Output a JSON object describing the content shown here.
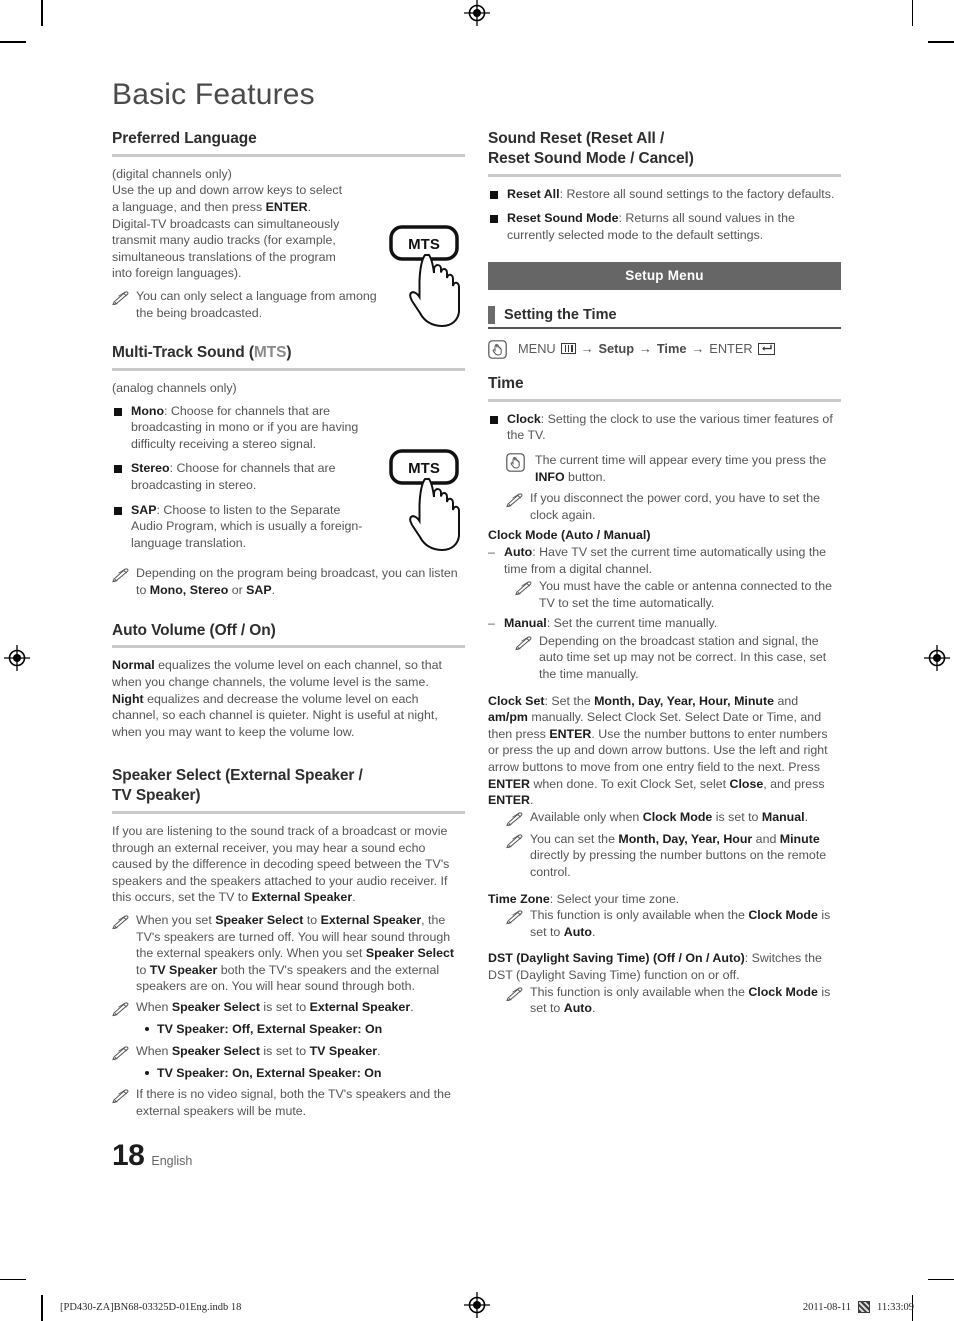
{
  "document": {
    "title": "Basic Features",
    "page_number": "18",
    "page_language": "English"
  },
  "left_column": {
    "preferred_language": {
      "heading": "Preferred Language",
      "p1": "(digital channels only)",
      "p2_a": "Use the up and down arrow keys to select a language, and then press ",
      "p2_b": "ENTER",
      "p2_c": ".",
      "p3": "Digital-TV broadcasts can simultaneously transmit many audio tracks (for example, simultaneous translations of the program into foreign languages).",
      "note1": "You can only select a language from among the being broadcasted.",
      "remote_button_label": "MTS"
    },
    "multi_track_sound": {
      "heading_main": "Multi-Track Sound (",
      "heading_muted": "MTS",
      "heading_tail": ")",
      "p1": "(analog channels only)",
      "items": [
        {
          "term": "Mono",
          "desc": ": Choose for channels that are broadcasting in mono or if you are having difficulty receiving a stereo signal."
        },
        {
          "term": "Stereo",
          "desc": ": Choose for channels that are broadcasting in stereo."
        },
        {
          "term": "SAP",
          "desc": ": Choose to listen to the Separate Audio Program, which is usually a foreign-language translation."
        }
      ],
      "note1_a": "Depending on the program being broadcast, you can listen to ",
      "note1_b": "Mono, Stereo",
      "note1_c": " or ",
      "note1_d": "SAP",
      "note1_e": ".",
      "remote_button_label": "MTS"
    },
    "auto_volume": {
      "heading": "Auto Volume (Off / On)",
      "p1_b": "Normal",
      "p1_t": " equalizes the volume level on each channel, so that when you change channels, the volume level is the same.",
      "p2_b": "Night",
      "p2_t": " equalizes and decrease the volume level on each channel, so each channel is quieter. Night is useful at night, when you may want to keep the volume low."
    },
    "speaker_select": {
      "heading_line1": "Speaker Select (External Speaker /",
      "heading_line2": "TV Speaker)",
      "p1_a": "If you are listening to the sound track of a broadcast or movie through an external receiver, you may hear a sound echo caused by the difference in decoding speed between the TV's speakers and the speakers attached to your audio receiver. If this occurs, set the TV to ",
      "p1_b": "External Speaker",
      "p1_c": ".",
      "note1_a": "When you set ",
      "note1_b": "Speaker Select",
      "note1_c": " to ",
      "note1_d": "External Speaker",
      "note1_e": ", the TV's speakers are turned off. You will hear sound through the external speakers only. When you set ",
      "note1_f": "Speaker Select",
      "note1_g": " to ",
      "note1_h": "TV Speaker",
      "note1_i": " both the TV's speakers and the external speakers are on. You will hear sound through both.",
      "note2_a": "When ",
      "note2_b": "Speaker Select",
      "note2_c": " is set to ",
      "note2_d": "External Speaker",
      "note2_e": ".",
      "bullet2": "TV Speaker: Off, External Speaker: On",
      "note3_a": "When ",
      "note3_b": "Speaker Select",
      "note3_c": " is set to ",
      "note3_d": "TV Speaker",
      "note3_e": ".",
      "bullet3": "TV Speaker: On, External Speaker: On",
      "note4": "If there is no video signal, both the TV's speakers and the external speakers will be mute."
    }
  },
  "right_column": {
    "sound_reset": {
      "heading_line1": "Sound Reset (Reset All /",
      "heading_line2": "Reset Sound Mode / Cancel)",
      "items": [
        {
          "term": "Reset All",
          "desc": ": Restore all sound settings to the factory defaults."
        },
        {
          "term": "Reset Sound Mode",
          "desc": ": Returns all sound values in the currently selected mode to the default settings."
        }
      ]
    },
    "banner": "Setup Menu",
    "setting_the_time": {
      "heading": "Setting the Time",
      "nav": {
        "menu": "MENU",
        "arrow": "→",
        "setup": "Setup",
        "time": "Time",
        "enter": "ENTER"
      }
    },
    "time": {
      "heading": "Time",
      "clock_item_term": "Clock",
      "clock_item_desc": ": Setting the clock to use the various timer features of the TV.",
      "hand_note_a": "The current time will appear every time you press the ",
      "hand_note_b": "INFO",
      "hand_note_c": " button.",
      "note1": "If you disconnect the power cord, you have to set the clock again.",
      "clock_mode_heading": "Clock Mode (Auto / Manual)",
      "auto_term": "Auto",
      "auto_desc": ": Have TV set the current time automatically using the time from a digital channel.",
      "auto_note": "You must have the cable or antenna connected to the TV to set the time automatically.",
      "manual_term": "Manual",
      "manual_desc": ": Set the current time manually.",
      "manual_note": "Depending on the broadcast station and signal, the auto time set up may not be correct. In this case, set the time manually.",
      "clock_set_b1": "Clock Set",
      "clock_set_t1": ": Set the ",
      "clock_set_b2": "Month, Day, Year, Hour, Minute",
      "clock_set_t2": " and ",
      "clock_set_b3": "am/pm",
      "clock_set_t3": " manually. Select Clock Set. Select Date or Time, and then press ",
      "clock_set_b4": "ENTER",
      "clock_set_t4": ". Use the number buttons to enter numbers or press the up and down arrow buttons. Use the left and right arrow buttons to move from one entry field to the next. Press ",
      "clock_set_b5": "ENTER",
      "clock_set_t5": " when done. To exit Clock Set, selet ",
      "clock_set_b6": "Close",
      "clock_set_t6": ", and press ",
      "clock_set_b7": "ENTER",
      "clock_set_t7": ".",
      "cs_note1_a": "Available only when ",
      "cs_note1_b": "Clock Mode",
      "cs_note1_c": " is set to ",
      "cs_note1_d": "Manual",
      "cs_note1_e": ".",
      "cs_note2_a": "You can set the ",
      "cs_note2_b": "Month, Day, Year, Hour",
      "cs_note2_c": " and ",
      "cs_note2_d": "Minute",
      "cs_note2_e": " directly by pressing the number buttons on the remote control.",
      "time_zone_b": "Time Zone",
      "time_zone_t": ": Select your time zone.",
      "tz_note_a": "This function is only available when the ",
      "tz_note_b": "Clock Mode",
      "tz_note_c": " is set to ",
      "tz_note_d": "Auto",
      "tz_note_e": ".",
      "dst_b": "DST (Daylight Saving Time) (Off / On / Auto)",
      "dst_t": ": Switches the DST (Daylight Saving Time) function on or off.",
      "dst_note_a": "This function is only available when the ",
      "dst_note_b": "Clock Mode",
      "dst_note_c": " is set to ",
      "dst_note_d": "Auto",
      "dst_note_e": "."
    }
  },
  "print_footer": {
    "left": "[PD430-ZA]BN68-03325D-01Eng.indb   18",
    "date": "2011-08-11",
    "time": "11:33:09"
  },
  "colors": {
    "banner_bg": "#666666",
    "rule": "#c9c9c9",
    "body_text": "#555555",
    "bold_text": "#1d1d1d"
  }
}
